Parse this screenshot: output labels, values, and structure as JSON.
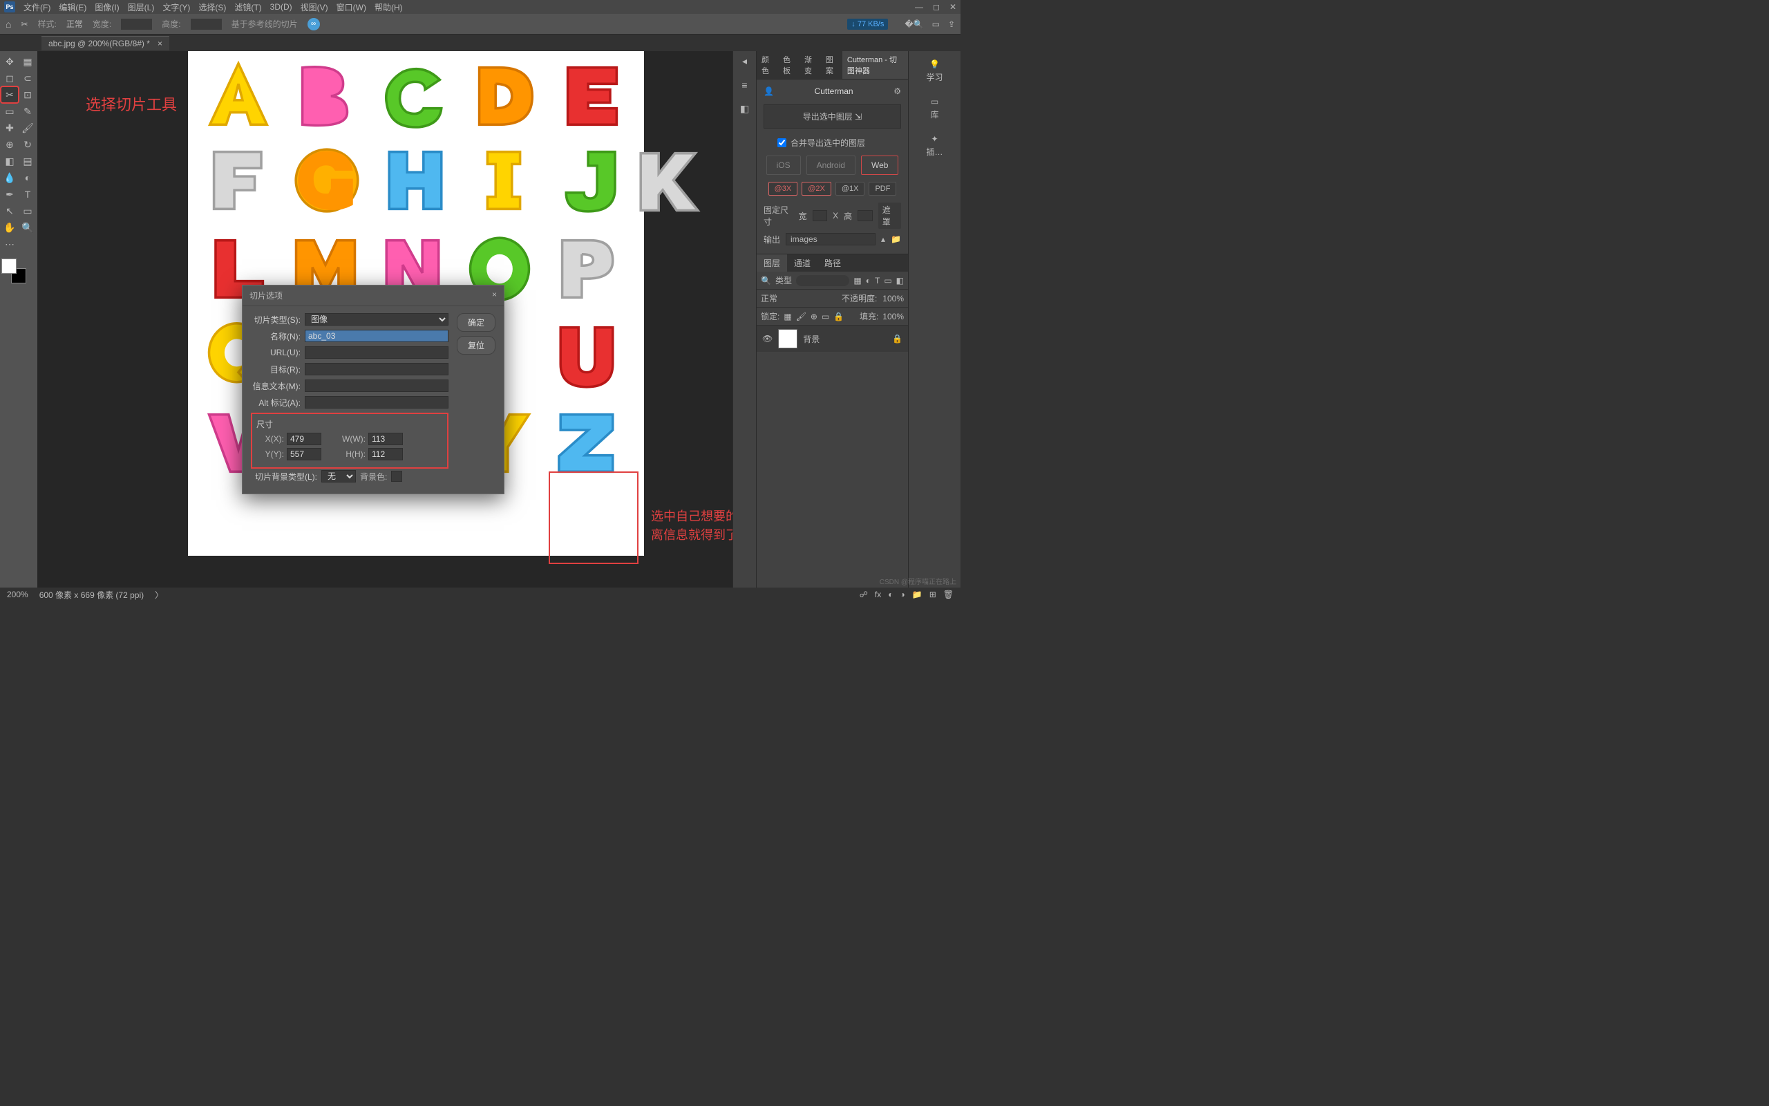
{
  "menu": {
    "items": [
      "文件(F)",
      "编辑(E)",
      "图像(I)",
      "图层(L)",
      "文字(Y)",
      "选择(S)",
      "滤镜(T)",
      "3D(D)",
      "视图(V)",
      "窗口(W)",
      "帮助(H)"
    ]
  },
  "optbar": {
    "style_lbl": "样式:",
    "style_val": "正常",
    "width_lbl": "宽度:",
    "height_lbl": "高度:",
    "guide": "基于参考线的切片",
    "speed": "↓ 77 KB/s"
  },
  "tab": {
    "title": "abc.jpg @ 200%(RGB/8#) *",
    "close": "×"
  },
  "annot": {
    "a1": "选择切片工具",
    "a2": "选中自己想要的内容，然后双击，宽高和精灵图要移动的距离信息就得到了"
  },
  "dialog": {
    "title": "切片选项",
    "close": "×",
    "type_lbl": "切片类型(S):",
    "type_val": "图像",
    "name_lbl": "名称(N):",
    "name_val": "abc_03",
    "url_lbl": "URL(U):",
    "url_val": "",
    "target_lbl": "目标(R):",
    "target_val": "",
    "message_lbl": "信息文本(M):",
    "message_val": "",
    "alt_lbl": "Alt 标记(A):",
    "alt_val": "",
    "dim_title": "尺寸",
    "x_lbl": "X(X):",
    "x_val": "479",
    "w_lbl": "W(W):",
    "w_val": "113",
    "y_lbl": "Y(Y):",
    "y_val": "557",
    "h_lbl": "H(H):",
    "h_val": "112",
    "bgtype_lbl": "切片背景类型(L):",
    "bgtype_val": "无",
    "bgcolor_lbl": "背景色:",
    "ok": "确定",
    "reset": "复位"
  },
  "cutterman": {
    "tabs": [
      "颜色",
      "色板",
      "渐变",
      "图案"
    ],
    "tab_act": "Cutterman - 切图神器",
    "title": "Cutterman",
    "export": "导出选中图层",
    "merge": "合并导出选中的图层",
    "plat": [
      "iOS",
      "Android",
      "Web"
    ],
    "scale": [
      "@3X",
      "@2X",
      "@1X",
      "PDF"
    ],
    "fixed": "固定尺寸",
    "w": "宽",
    "h": "高",
    "mask": "遮罩",
    "output_lbl": "输出",
    "output_path": "images"
  },
  "layers": {
    "tabs": [
      "图层",
      "通道",
      "路径"
    ],
    "kind": "类型",
    "mode": "正常",
    "opacity_lbl": "不透明度:",
    "opacity": "100%",
    "lock": "锁定:",
    "fill_lbl": "填充:",
    "fill": "100%",
    "bg_layer": "背景"
  },
  "learn": {
    "learn": "学习",
    "lib": "库",
    "plugin": "插…"
  },
  "status": {
    "zoom": "200%",
    "dim": "600 像素 x 669 像素 (72 ppi)",
    "wm": "CSDN @程序喵正在路上"
  }
}
